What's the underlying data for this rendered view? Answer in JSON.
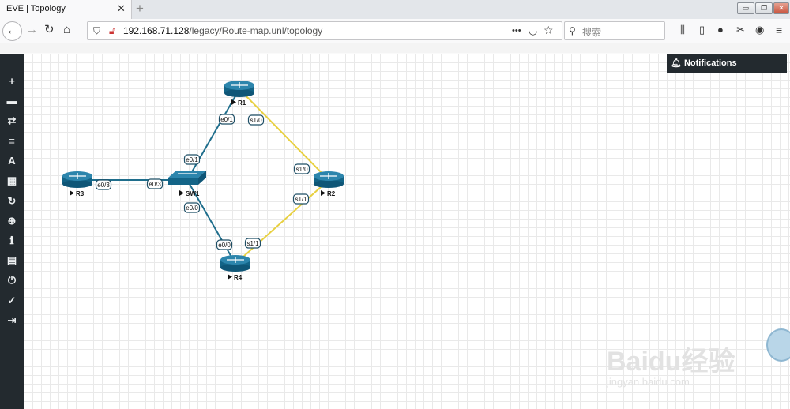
{
  "browser": {
    "tab_title": "EVE | Topology",
    "tab_close": "✕",
    "new_tab": "+",
    "url_host": "192.168.71.128",
    "url_path": "/legacy/Route-map.unl/topology",
    "search_placeholder": "搜索",
    "page_actions": "•••"
  },
  "sidebar": {
    "items": [
      {
        "name": "add-object-icon",
        "glyph": "+"
      },
      {
        "name": "nodes-icon",
        "glyph": "▬"
      },
      {
        "name": "networks-icon",
        "glyph": "⇄"
      },
      {
        "name": "startup-configs-icon",
        "glyph": "≡"
      },
      {
        "name": "text-objects-icon",
        "glyph": "A"
      },
      {
        "name": "grid-view-icon",
        "glyph": "▦"
      },
      {
        "name": "refresh-icon",
        "glyph": "↻"
      },
      {
        "name": "zoom-icon",
        "glyph": "⊕"
      },
      {
        "name": "info-icon",
        "glyph": "ℹ"
      },
      {
        "name": "lab-details-icon",
        "glyph": "▤"
      },
      {
        "name": "power-icon",
        "glyph": "⏻"
      },
      {
        "name": "check-icon",
        "glyph": "✓"
      },
      {
        "name": "logout-icon",
        "glyph": "⇥"
      }
    ]
  },
  "notifications": {
    "label": "Notifications"
  },
  "topology": {
    "nodes": [
      {
        "id": "R1",
        "label": "R1",
        "type": "router"
      },
      {
        "id": "R2",
        "label": "R2",
        "type": "router"
      },
      {
        "id": "R3",
        "label": "R3",
        "type": "router"
      },
      {
        "id": "R4",
        "label": "R4",
        "type": "router"
      },
      {
        "id": "SW1",
        "label": "SW1",
        "type": "switch"
      }
    ],
    "links": [
      {
        "from": "R1",
        "to": "SW1",
        "from_if": "e0/1",
        "to_if": "e0/1",
        "kind": "ethernet",
        "color": "#1f6e8c"
      },
      {
        "from": "R1",
        "to": "R2",
        "from_if": "s1/0",
        "to_if": "s1/0",
        "kind": "serial",
        "color": "#e8d040"
      },
      {
        "from": "R3",
        "to": "SW1",
        "from_if": "e0/3",
        "to_if": "e0/3",
        "kind": "ethernet",
        "color": "#1f6e8c"
      },
      {
        "from": "SW1",
        "to": "R4",
        "from_if": "e0/0",
        "to_if": "e0/0",
        "kind": "ethernet",
        "color": "#1f6e8c"
      },
      {
        "from": "R2",
        "to": "R4",
        "from_if": "s1/1",
        "to_if": "s1/1",
        "kind": "serial",
        "color": "#e8d040"
      }
    ]
  },
  "watermark": {
    "brand": "Baidu经验",
    "url": "jingyan.baidu.com"
  }
}
